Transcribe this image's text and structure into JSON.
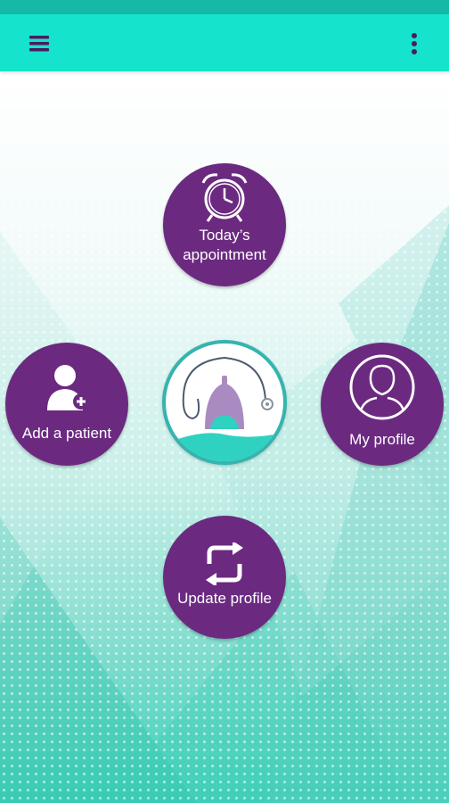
{
  "app_bar": {
    "menu_icon": "hamburger-menu-icon",
    "more_icon": "more-vertical-icon"
  },
  "colors": {
    "status_bar": "#16b8a6",
    "app_bar": "#15e3cc",
    "button_purple": "#6b2a80",
    "logo_ring": "#35b4b0",
    "background_bottom": "#3fcfb9"
  },
  "menu": {
    "appointment": {
      "label_line1": "Today’s",
      "label_line2": "appointment",
      "icon": "alarm-clock-icon"
    },
    "add_patient": {
      "label": "Add a patient",
      "icon": "add-user-icon"
    },
    "my_profile": {
      "label": "My profile",
      "icon": "user-profile-icon"
    },
    "update_profile": {
      "label": "Update profile",
      "icon": "refresh-icon"
    }
  },
  "logo": {
    "icon": "stethoscope-doctor-logo-icon"
  }
}
